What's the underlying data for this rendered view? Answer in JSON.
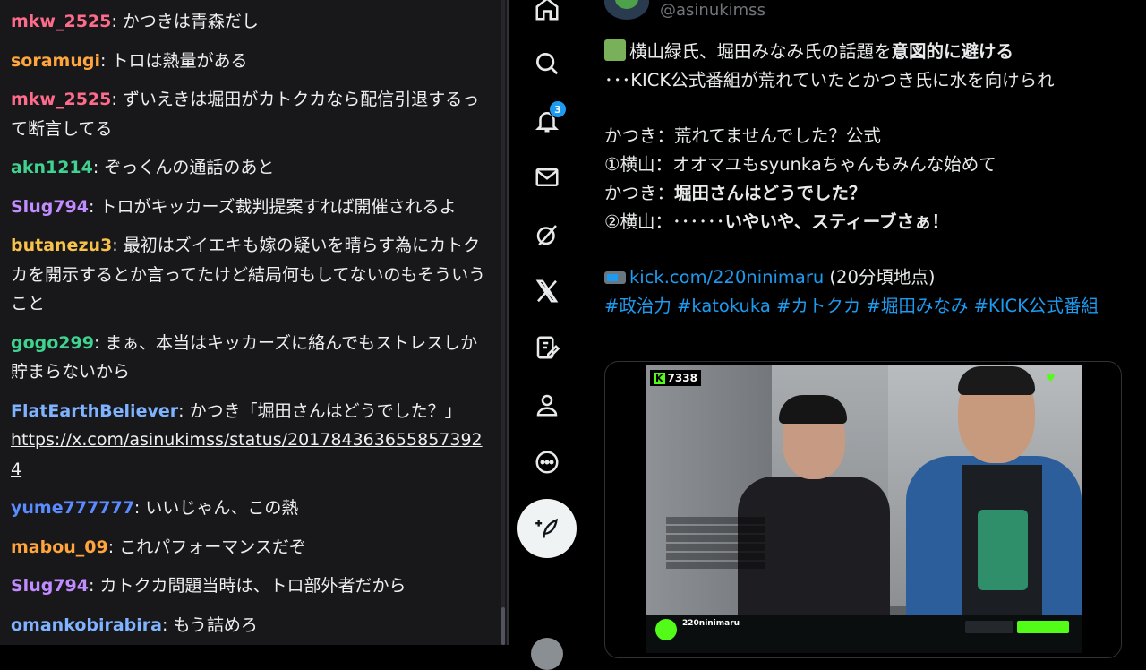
{
  "chat": {
    "messages": [
      {
        "user": "mkw_2525",
        "color": "#ff6b8a",
        "text": "かつきは青森だし"
      },
      {
        "user": "soramugi",
        "color": "#ffa53b",
        "text": "トロは熱量がある"
      },
      {
        "user": "mkw_2525",
        "color": "#ff6b8a",
        "text": "ずいえきは堀田がカトクカなら配信引退するって断言してる"
      },
      {
        "user": "akn1214",
        "color": "#3fd38f",
        "text": "ぞっくんの通話のあと"
      },
      {
        "user": "Slug794",
        "color": "#c08cff",
        "text": "トロがキッカーズ裁判提案すれば開催されるよ"
      },
      {
        "user": "butanezu3",
        "color": "#f7c14a",
        "text": "最初はズイエキも嫁の疑いを晴らす為にカトクカを開示するとか言ってたけど結局何もしてないのもそういうこと"
      },
      {
        "user": "gogo299",
        "color": "#3fd38f",
        "text": "まぁ、本当はキッカーズに絡んでもストレスしか貯まらないから"
      },
      {
        "user": "FlatEarthBeliever",
        "color": "#7fb3ff",
        "text": "かつき「堀田さんはどうでした？」",
        "link": "https://x.com/asinukimss/status/2017843636558573924"
      },
      {
        "user": "yume777777",
        "color": "#5b8cff",
        "text": "いいじゃん、この熱"
      },
      {
        "user": "mabou_09",
        "color": "#ffa53b",
        "text": "これパフォーマンスだぞ"
      },
      {
        "user": "Slug794",
        "color": "#c08cff",
        "text": "カトクカ問題当時は、トロ部外者だから"
      },
      {
        "user": "omankobirabira",
        "color": "#7fb3ff",
        "text": "もう詰めろ"
      }
    ]
  },
  "nav": {
    "items": [
      "home-icon",
      "search-icon",
      "bell-icon",
      "mail-icon",
      "grok-icon",
      "x-logo-icon",
      "compose-list-icon",
      "profile-icon",
      "more-icon"
    ],
    "notification_count": "3",
    "post_button_icon": "feather-plus-icon"
  },
  "tweet": {
    "handle": "@asinukimss",
    "line1_plain": "横山緑氏、堀田みなみ氏の話題を",
    "line1_bold": "意図的に避ける",
    "line2": "･･･KICK公式番組が荒れていたとかつき氏に水を向けられ",
    "line3": "かつき：荒れてませんでした？公式",
    "line4": "①横山：オオマユもsyunkaちゃんもみんな始めて",
    "line5_plain": "かつき：",
    "line5_bold": "堀田さんはどうでした？",
    "line6_plain": "②横山：･･････",
    "line6_bold": "いやいや、スティーブさぁ！",
    "link_text": "kick.com/220ninimaru",
    "link_suffix": " (20分頃地点)",
    "hashtags": "#政治力 #katokuka #カトクカ #堀田みなみ #KICK公式番組"
  },
  "media": {
    "viewer_count": "7338",
    "kick_mark": "K",
    "streamer_name": "220ninimaru"
  }
}
